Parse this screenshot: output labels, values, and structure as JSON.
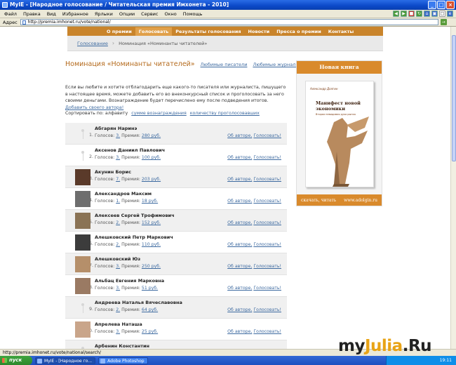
{
  "window": {
    "title": "MyIE - [Народное голосование / Читательская премия Имхонета - 2010]"
  },
  "menu": [
    "Файл",
    "Правка",
    "Вид",
    "Избранное",
    "Ярлыки",
    "Опции",
    "Сервис",
    "Окно",
    "Помощь"
  ],
  "address": {
    "label": "Адрес",
    "url": "http://premia.imhonet.ru/vote/national/"
  },
  "nav": {
    "items": [
      "О премии",
      "Голосовать",
      "Результаты голосования",
      "Новости",
      "Пресса о премии",
      "Контакты"
    ],
    "active_index": 1
  },
  "breadcrumb": {
    "link": "Голосование",
    "current": "Номинация «Номинанты читателей»"
  },
  "heading": {
    "title": "Номинация «Номинанты читателей»",
    "tab1": "Любимые писатели",
    "tab2": "Любимые журналисты"
  },
  "intro": {
    "text": "Если вы любите и хотите отблагодарить еще какого-то писателя или журналиста, пишущего в настоящее время, можете добавить его во внеконкурсный список и проголосовать за него своими деньгами. Вознаграждение будет перечислено ему после подведения итогов.",
    "link": "Добавить своего автора!"
  },
  "sort": {
    "label": "Сортировать по: алфавиту",
    "opt1": "сумме вознаграждения",
    "opt2": "количеству проголосовавших"
  },
  "labels": {
    "votes": "Голосов:",
    "prizes": "Премия:",
    "about": "Об авторе,",
    "vote": "Голосовать!"
  },
  "nominees": [
    {
      "num": "1.",
      "name": "Абгарян Наринэ",
      "votes": "3.",
      "prize": "280 руб.",
      "photo": "none"
    },
    {
      "num": "2.",
      "name": "Аксенов Даниил Павлович",
      "votes": "3.",
      "prize": "100 руб.",
      "photo": "none"
    },
    {
      "num": "3.",
      "name": "Акунин Борис",
      "votes": "7.",
      "prize": "203 руб.",
      "photo": "#5a3a2a"
    },
    {
      "num": "4.",
      "name": "Александров Максим",
      "votes": "1.",
      "prize": "18 руб.",
      "photo": "#6e6e6e"
    },
    {
      "num": "5.",
      "name": "Алексеев Сергей Трофимович",
      "votes": "2.",
      "prize": "152 руб.",
      "photo": "#8a7355"
    },
    {
      "num": "6.",
      "name": "Алешковский Петр Маркович",
      "votes": "2.",
      "prize": "110 руб.",
      "photo": "#3c3c3c"
    },
    {
      "num": "7.",
      "name": "Алешковский Юз",
      "votes": "3.",
      "prize": "250 руб.",
      "photo": "#b58f6a"
    },
    {
      "num": "8.",
      "name": "Альбац Евгения Марковна",
      "votes": "3.",
      "prize": "51 руб.",
      "photo": "#9a7a63"
    },
    {
      "num": "9.",
      "name": "Андреева Наталья Вячеславовна",
      "votes": "2.",
      "prize": "64 руб.",
      "photo": "none"
    },
    {
      "num": "10.",
      "name": "Апрелева Наташа",
      "votes": "3.",
      "prize": "25 руб.",
      "photo": "#c9a58a"
    },
    {
      "num": "",
      "name": "Арбенин Константин",
      "votes": "",
      "prize": "",
      "photo": "none"
    }
  ],
  "ad": {
    "header": "Новая книга",
    "book_author": "Александр Долгин",
    "book_title": "Манифест новой экономики",
    "book_subtitle": "Вторая невидимая рука рынка",
    "footer_left": "скачать, читать",
    "footer_right": "www.adolgin.ru"
  },
  "status": {
    "text": "http://premia.imhonet.ru/vote/national/search/"
  },
  "taskbar": {
    "start": "пуск",
    "task1": "MyIE - [Народное го...",
    "task2": "Adobe Photoshop",
    "time": "19:11"
  },
  "watermark": {
    "part1": "my",
    "part2": "Julia",
    "part3": ".Ru"
  },
  "colors": {
    "nav_bg": "#c9842b",
    "title": "#b46a1c",
    "link": "#3d6aa0",
    "ad_accent": "#d98a2c"
  }
}
